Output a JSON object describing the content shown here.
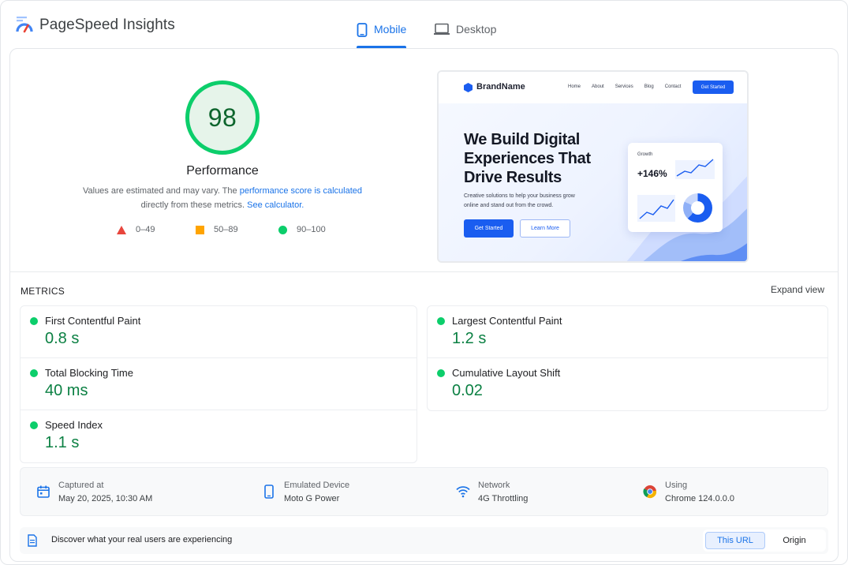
{
  "app": {
    "title": "PageSpeed Insights"
  },
  "tabs": [
    {
      "label": "Mobile",
      "active": true
    },
    {
      "label": "Desktop",
      "active": false
    }
  ],
  "score": {
    "value": "98",
    "label": "Performance",
    "desc_prefix": "Values are estimated and may vary. The ",
    "desc_link1": "performance score is calculated",
    "desc_middle": "directly from these metrics. ",
    "desc_link2": "See calculator.",
    "legend": [
      {
        "range": "0–49",
        "color": "#e8453c"
      },
      {
        "range": "50–89",
        "color": "#ffa400"
      },
      {
        "range": "90–100",
        "color": "#0cce6b"
      }
    ]
  },
  "preview": {
    "brand": "BrandName",
    "nav_links": [
      "Home",
      "About",
      "Services",
      "Blog",
      "Contact"
    ],
    "nav_cta": "Get Started",
    "headline": "We Build Digital Experiences That Drive Results",
    "subtext": "Creative solutions to help your business grow online and stand out from the crowd.",
    "primary_button": "Get Started",
    "secondary_button": "Learn More",
    "card_label": "Growth",
    "card_value": "+146%"
  },
  "metrics": {
    "title": "METRICS",
    "expand_label": "Expand view",
    "left": [
      {
        "name": "First Contentful Paint",
        "value": "0.8 s"
      },
      {
        "name": "Total Blocking Time",
        "value": "40 ms"
      },
      {
        "name": "Speed Index",
        "value": "1.1 s"
      }
    ],
    "right": [
      {
        "name": "Largest Contentful Paint",
        "value": "1.2 s"
      },
      {
        "name": "Cumulative Layout Shift",
        "value": "0.02"
      }
    ]
  },
  "info": [
    {
      "icon": "calendar-icon",
      "label": "Captured at",
      "value": "May 20, 2025, 10:30 AM"
    },
    {
      "icon": "phone-icon",
      "label": "Emulated Device",
      "value": "Moto G Power"
    },
    {
      "icon": "wifi-icon",
      "label": "Network",
      "value": "4G Throttling"
    },
    {
      "icon": "chrome-icon",
      "label": "Using",
      "value": "Chrome 124.0.0.0"
    }
  ],
  "crux": {
    "text": "Discover what your real users are experiencing",
    "toggle": [
      {
        "label": "This URL",
        "active": true
      },
      {
        "label": "Origin",
        "active": false
      }
    ]
  },
  "colors": {
    "accent": "#1a73e8",
    "good": "#0cce6b",
    "good_text": "#0b8043"
  }
}
